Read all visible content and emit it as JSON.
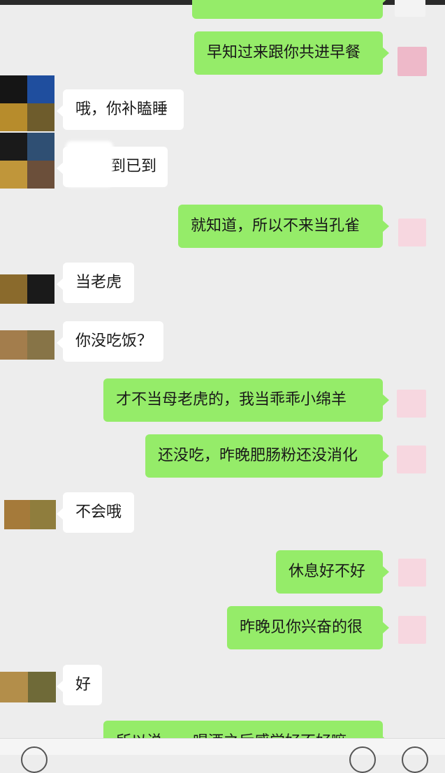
{
  "messages": [
    {
      "side": "right",
      "text": "",
      "partial": true
    },
    {
      "side": "right",
      "text": "早知过来跟你共进早餐"
    },
    {
      "side": "left",
      "text": "哦，你补瞌睡"
    },
    {
      "side": "left",
      "text": "到已到"
    },
    {
      "side": "right",
      "text": "就知道，所以不来当孔雀"
    },
    {
      "side": "left",
      "text": "当老虎"
    },
    {
      "side": "left",
      "text": "你没吃饭？"
    },
    {
      "side": "right",
      "text": "才不当母老虎的，我当乖乖小绵羊"
    },
    {
      "side": "right",
      "text": "还没吃，昨晚肥肠粉还没消化"
    },
    {
      "side": "left",
      "text": "不会哦"
    },
    {
      "side": "right",
      "text": "休息好不好"
    },
    {
      "side": "right",
      "text": "昨晚见你兴奋的很"
    },
    {
      "side": "left",
      "text": "好"
    },
    {
      "side": "right",
      "text": "所以说……喝酒之后感觉好不好嘛",
      "partial": true
    }
  ],
  "colors": {
    "background": "#EDEDED",
    "bubble_right": "#95EC69",
    "bubble_left": "#FFFFFF",
    "avatar_me": "#F7D7E0"
  },
  "icons": {
    "my_avatar": "pixelated-pink-avatar-icon",
    "their_avatar": "pixelated-mosaic-avatar-icon",
    "voice": "voice-icon",
    "emoji": "emoji-icon"
  }
}
